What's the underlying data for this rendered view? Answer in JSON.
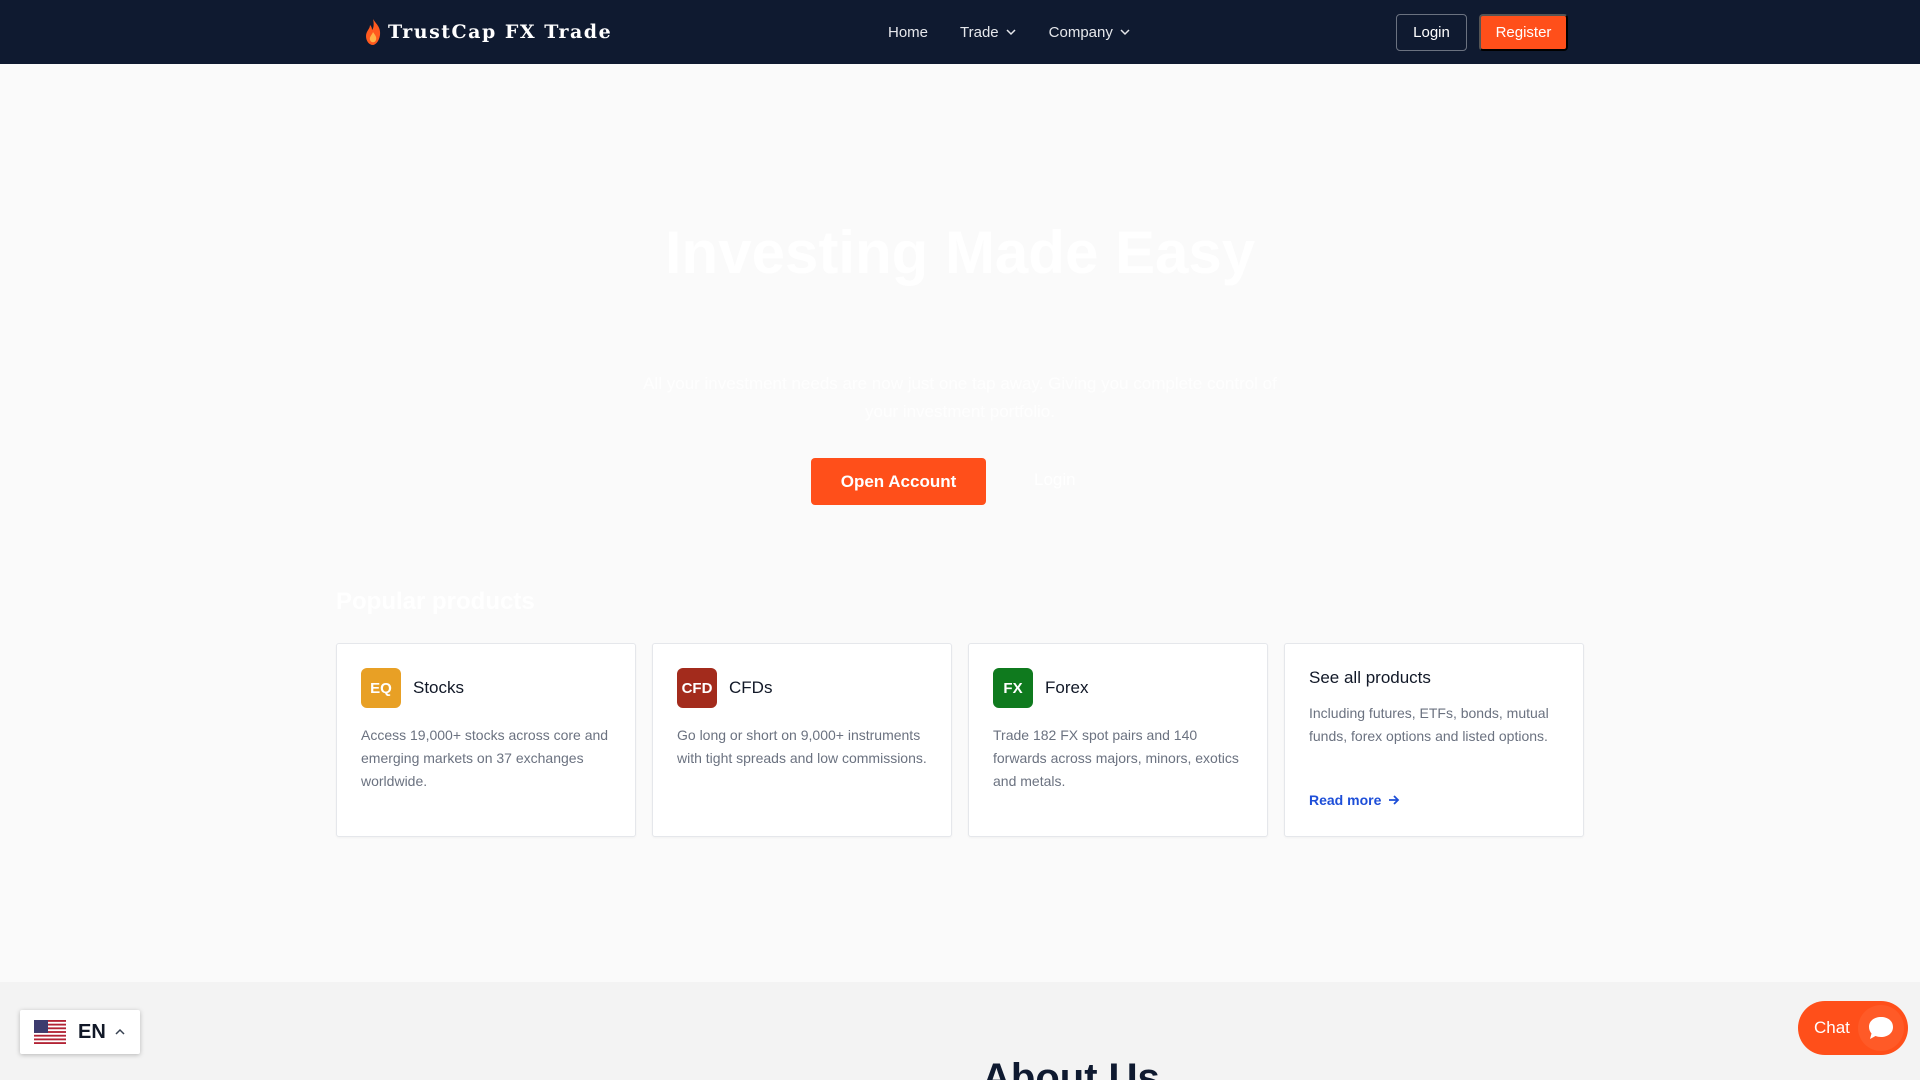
{
  "nav": {
    "brand": "TrustCap FX Trade",
    "links": [
      {
        "label": "Home"
      },
      {
        "label": "Trade"
      },
      {
        "label": "Company"
      }
    ],
    "login_label": "Login",
    "register_label": "Register"
  },
  "hero": {
    "title": "Investing Made Easy",
    "subtitle": "All your investment needs are now just one tap away. Giving you complete control of your investment portfolio.",
    "open_account_label": "Open Account",
    "login_label": "Login"
  },
  "products": {
    "heading": "Popular products",
    "cards": [
      {
        "badge": "EQ",
        "badge_color": "#e8a025",
        "title": "Stocks",
        "description": "Access 19,000+ stocks across core and emerging markets on 37 exchanges worldwide."
      },
      {
        "badge": "CFD",
        "badge_color": "#a32b1c",
        "title": "CFDs",
        "description": "Go long or short on 9,000+ instruments with tight spreads and low commissions."
      },
      {
        "badge": "FX",
        "badge_color": "#0f7a1e",
        "title": "Forex",
        "description": "Trade 182 FX spot pairs and 140 forwards across majors, minors, exotics and metals."
      }
    ],
    "all": {
      "title": "See all products",
      "description": "Including futures, ETFs, bonds, mutual funds, forex options and listed options.",
      "link": "Read more"
    }
  },
  "about": {
    "heading": "About Us"
  },
  "language": {
    "code": "EN",
    "flag": "us-flag"
  },
  "chat": {
    "label": "Chat"
  },
  "colors": {
    "nav_bg": "#0f1a30",
    "accent": "#ff4f1a",
    "link": "#1d4ed8"
  }
}
